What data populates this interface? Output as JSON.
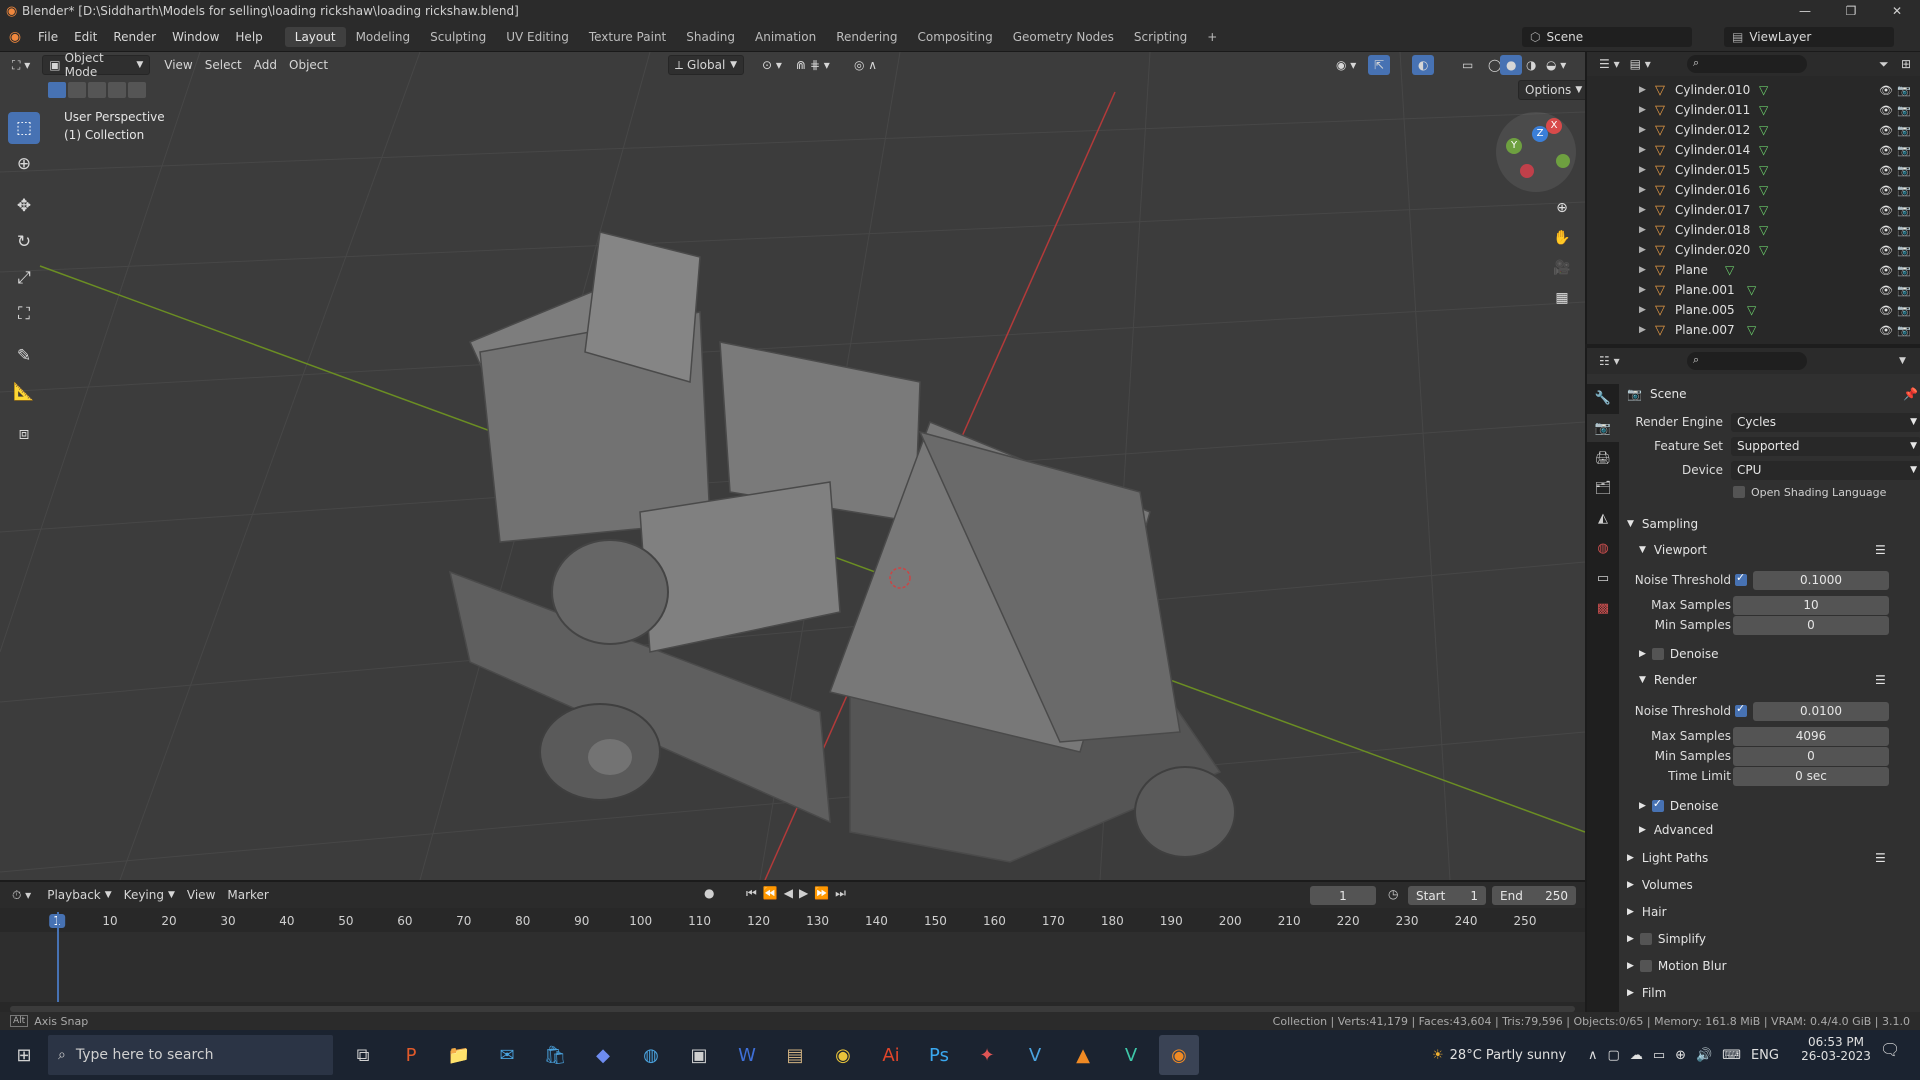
{
  "window": {
    "title": "Blender* [D:\\Siddharth\\Models for selling\\loading rickshaw\\loading rickshaw.blend]",
    "minimize": "—",
    "maximize": "❐",
    "close": "✕"
  },
  "menu": [
    "File",
    "Edit",
    "Render",
    "Window",
    "Help"
  ],
  "workspaces": [
    "Layout",
    "Modeling",
    "Sculpting",
    "UV Editing",
    "Texture Paint",
    "Shading",
    "Animation",
    "Rendering",
    "Compositing",
    "Geometry Nodes",
    "Scripting"
  ],
  "workspace_add": "+",
  "scene_name": "Scene",
  "view_layer": "ViewLayer",
  "viewport": {
    "mode": "Object Mode",
    "menus": [
      "View",
      "Select",
      "Add",
      "Object"
    ],
    "transform": "Global",
    "options": "Options",
    "overlay_line1": "User Perspective",
    "overlay_line2": "(1) Collection",
    "gizmo": {
      "x": "X",
      "y": "Y",
      "z": "Z"
    }
  },
  "outliner": {
    "items": [
      "Cylinder.010",
      "Cylinder.011",
      "Cylinder.012",
      "Cylinder.014",
      "Cylinder.015",
      "Cylinder.016",
      "Cylinder.017",
      "Cylinder.018",
      "Cylinder.020",
      "Plane",
      "Plane.001",
      "Plane.005",
      "Plane.007"
    ]
  },
  "properties": {
    "header": "Scene",
    "render_engine_label": "Render Engine",
    "render_engine": "Cycles",
    "feature_set_label": "Feature Set",
    "feature_set": "Supported",
    "device_label": "Device",
    "device": "CPU",
    "osl_label": "Open Shading Language",
    "sampling": "Sampling",
    "viewport": "Viewport",
    "vp_noise_label": "Noise Threshold",
    "vp_noise": "0.1000",
    "vp_max_label": "Max Samples",
    "vp_max": "10",
    "vp_min_label": "Min Samples",
    "vp_min": "0",
    "vp_denoise": "Denoise",
    "render": "Render",
    "r_noise_label": "Noise Threshold",
    "r_noise": "0.0100",
    "r_max_label": "Max Samples",
    "r_max": "4096",
    "r_min_label": "Min Samples",
    "r_min": "0",
    "r_time_label": "Time Limit",
    "r_time": "0 sec",
    "r_denoise": "Denoise",
    "advanced": "Advanced",
    "light_paths": "Light Paths",
    "volumes": "Volumes",
    "hair": "Hair",
    "simplify": "Simplify",
    "motion_blur": "Motion Blur",
    "film": "Film"
  },
  "timeline": {
    "menus": [
      "Playback",
      "Keying",
      "View",
      "Marker"
    ],
    "current_frame": "1",
    "start_label": "Start",
    "start": "1",
    "end_label": "End",
    "end": "250",
    "ticks": [
      "1",
      "10",
      "20",
      "30",
      "40",
      "50",
      "60",
      "70",
      "80",
      "90",
      "100",
      "110",
      "120",
      "130",
      "140",
      "150",
      "160",
      "170",
      "180",
      "190",
      "200",
      "210",
      "220",
      "230",
      "240",
      "250"
    ]
  },
  "status": {
    "left": "Axis Snap",
    "right": "Collection | Verts:41,179 | Faces:43,604 | Tris:79,596 | Objects:0/65 | Memory: 161.8 MiB | VRAM: 0.4/4.0 GiB | 3.1.0"
  },
  "taskbar": {
    "search": "Type here to search",
    "weather": "28°C  Partly sunny",
    "lang": "ENG",
    "time": "06:53 PM",
    "date": "26-03-2023"
  }
}
